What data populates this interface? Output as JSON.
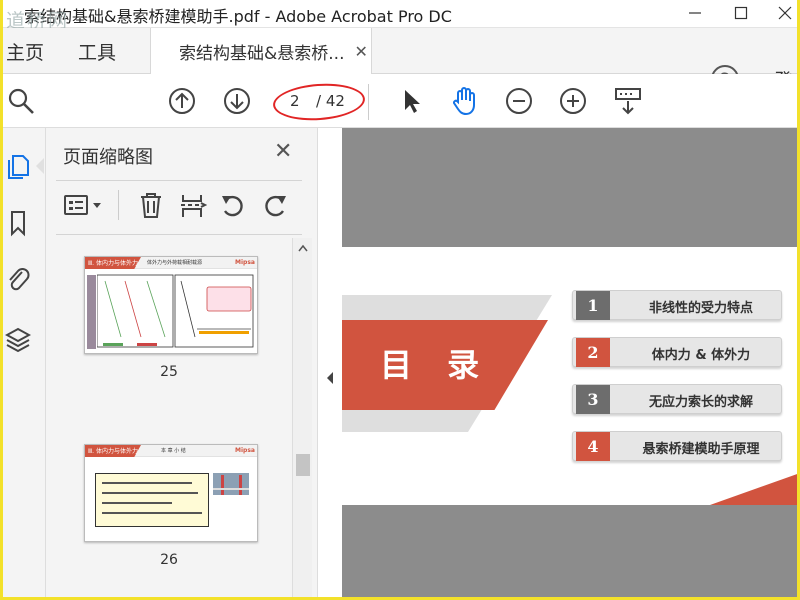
{
  "window": {
    "title": "索结构基础&悬索桥建模助手.pdf - Adobe Acrobat Pro DC",
    "watermark": "道桥网"
  },
  "menu": {
    "home": "主页",
    "tools": "工具",
    "doc_tab": "索结构基础&悬索桥...",
    "login": "登"
  },
  "toolbar": {
    "current_page": "2",
    "total_pages": "/ 42"
  },
  "panel": {
    "title": "页面缩略图",
    "thumbnails": [
      {
        "label": "25",
        "header": "Ⅲ. 体内力与体外力",
        "subheader": "体外力与外荷载相耐载源",
        "logo": "Mipsa"
      },
      {
        "label": "26",
        "header": "Ⅲ. 体内力与体外力",
        "subheader": "本 章 小 结",
        "logo": "Mipsa"
      }
    ]
  },
  "slide": {
    "banner": "目 录",
    "toc": [
      {
        "num": "1",
        "text": "非线性的受力特点",
        "color": "#6d6d6d"
      },
      {
        "num": "2",
        "text": "体内力 & 体外力",
        "color": "#d1543f"
      },
      {
        "num": "3",
        "text": "无应力索长的求解",
        "color": "#6d6d6d"
      },
      {
        "num": "4",
        "text": "悬索桥建模助手原理",
        "color": "#d1543f"
      }
    ]
  }
}
